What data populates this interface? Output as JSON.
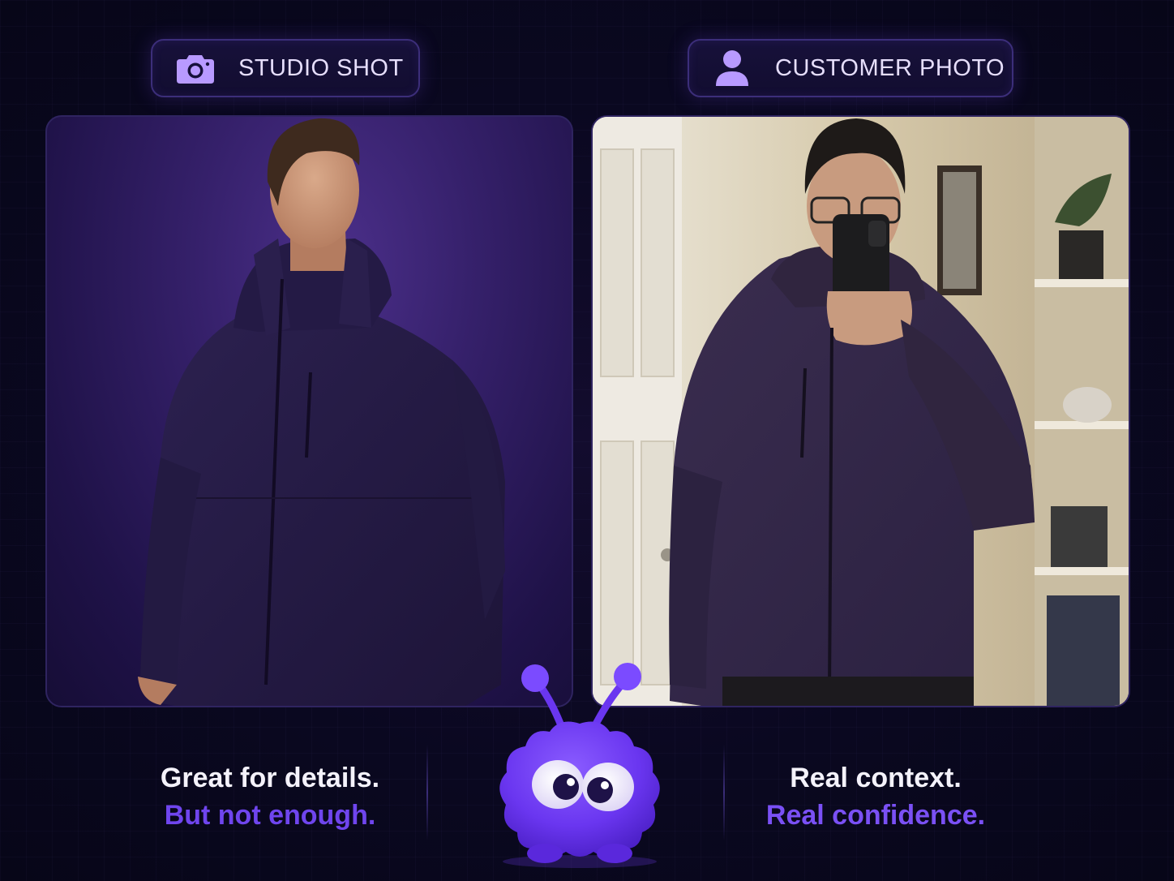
{
  "labels": {
    "studio": {
      "text": "STUDIO SHOT",
      "icon": "camera-icon"
    },
    "customer": {
      "text": "CUSTOMER PHOTO",
      "icon": "user-icon"
    }
  },
  "captions": {
    "left": {
      "line1": "Great for details.",
      "line2": "But not enough."
    },
    "right": {
      "line1": "Real context.",
      "line2": "Real confidence."
    }
  },
  "colors": {
    "background": "#0a0820",
    "accent": "#7a50f5",
    "pill_border": "#3c2e7a",
    "jacket": "#2a2045"
  },
  "images": {
    "studio": "studio-model-photo",
    "customer": "customer-mirror-selfie",
    "mascot": "purple-fuzzy-mascot"
  }
}
